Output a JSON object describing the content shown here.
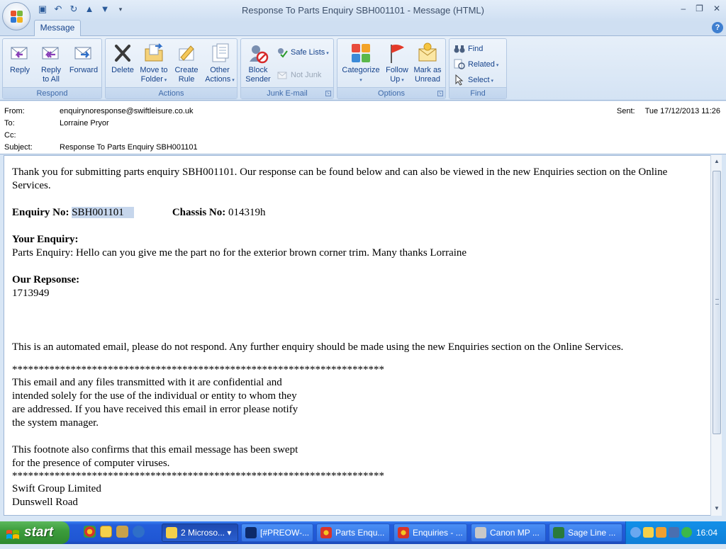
{
  "window": {
    "title": "Response To Parts Enquiry SBH001101 - Message (HTML)",
    "controls": [
      "–",
      "❐",
      "✕"
    ]
  },
  "ribbon": {
    "tab": "Message",
    "groups": {
      "respond": {
        "label": "Respond",
        "reply": "Reply",
        "reply_all_1": "Reply",
        "reply_all_2": "to All",
        "forward": "Forward"
      },
      "actions": {
        "label": "Actions",
        "delete": "Delete",
        "move_1": "Move to",
        "move_2": "Folder",
        "create_1": "Create",
        "create_2": "Rule",
        "other_1": "Other",
        "other_2": "Actions"
      },
      "junk": {
        "label": "Junk E-mail",
        "block_1": "Block",
        "block_2": "Sender",
        "safe_lists": "Safe Lists",
        "not_junk": "Not Junk"
      },
      "options": {
        "label": "Options",
        "categorize": "Categorize",
        "follow_1": "Follow",
        "follow_2": "Up",
        "mark_1": "Mark as",
        "mark_2": "Unread"
      },
      "find": {
        "label": "Find",
        "find": "Find",
        "related": "Related",
        "select": "Select"
      }
    }
  },
  "header": {
    "from_label": "From:",
    "from": "enquirynoresponse@swiftleisure.co.uk",
    "to_label": "To:",
    "to": "Lorraine Pryor",
    "cc_label": "Cc:",
    "cc": "",
    "subject_label": "Subject:",
    "subject": "Response To Parts Enquiry SBH001101",
    "sent_label": "Sent:",
    "sent": "Tue 17/12/2013 11:26"
  },
  "body": {
    "intro": "Thank you for submitting parts enquiry SBH001101. Our response can be found below and can also be viewed in the new Enquiries section on the Online Services.",
    "enquiry_no_label": "Enquiry No:",
    "enquiry_no": "SBH001101",
    "chassis_no_label": "Chassis No:",
    "chassis_no": "014319h",
    "your_enquiry_label": "Your Enquiry:",
    "your_enquiry": "Parts Enquiry: Hello can you give me the part no for the exterior brown corner trim. Many thanks Lorraine",
    "response_label": "Our Repsonse:",
    "response": "1713949",
    "automated": "This is an automated email, please do not respond. Any further enquiry should be made using the new Enquiries section on the Online Services.",
    "stars": "**********************************************************************",
    "disclaimer_1": "This email and any files transmitted with it are confidential and",
    "disclaimer_2": "intended solely for the use of the individual or entity to whom they",
    "disclaimer_3": "are addressed. If you have received this email in error please notify",
    "disclaimer_4": "the system manager.",
    "footnote_1": "This footnote also confirms that this email message has been swept",
    "footnote_2": "for the presence of computer viruses.",
    "company": "Swift Group Limited",
    "address_1": "Dunswell Road"
  },
  "taskbar": {
    "start": "start",
    "tasks": [
      "2 Microso...",
      "[#PREOW-...",
      "Parts Enqu...",
      "Enquiries - ...",
      "Canon MP ...",
      "Sage Line ..."
    ],
    "clock": "16:04"
  },
  "colors": {
    "accent": "#15428b",
    "ribbon_bg": "#d4e3f4",
    "taskbar": "#245edb",
    "selection": "#c6d6ec"
  }
}
